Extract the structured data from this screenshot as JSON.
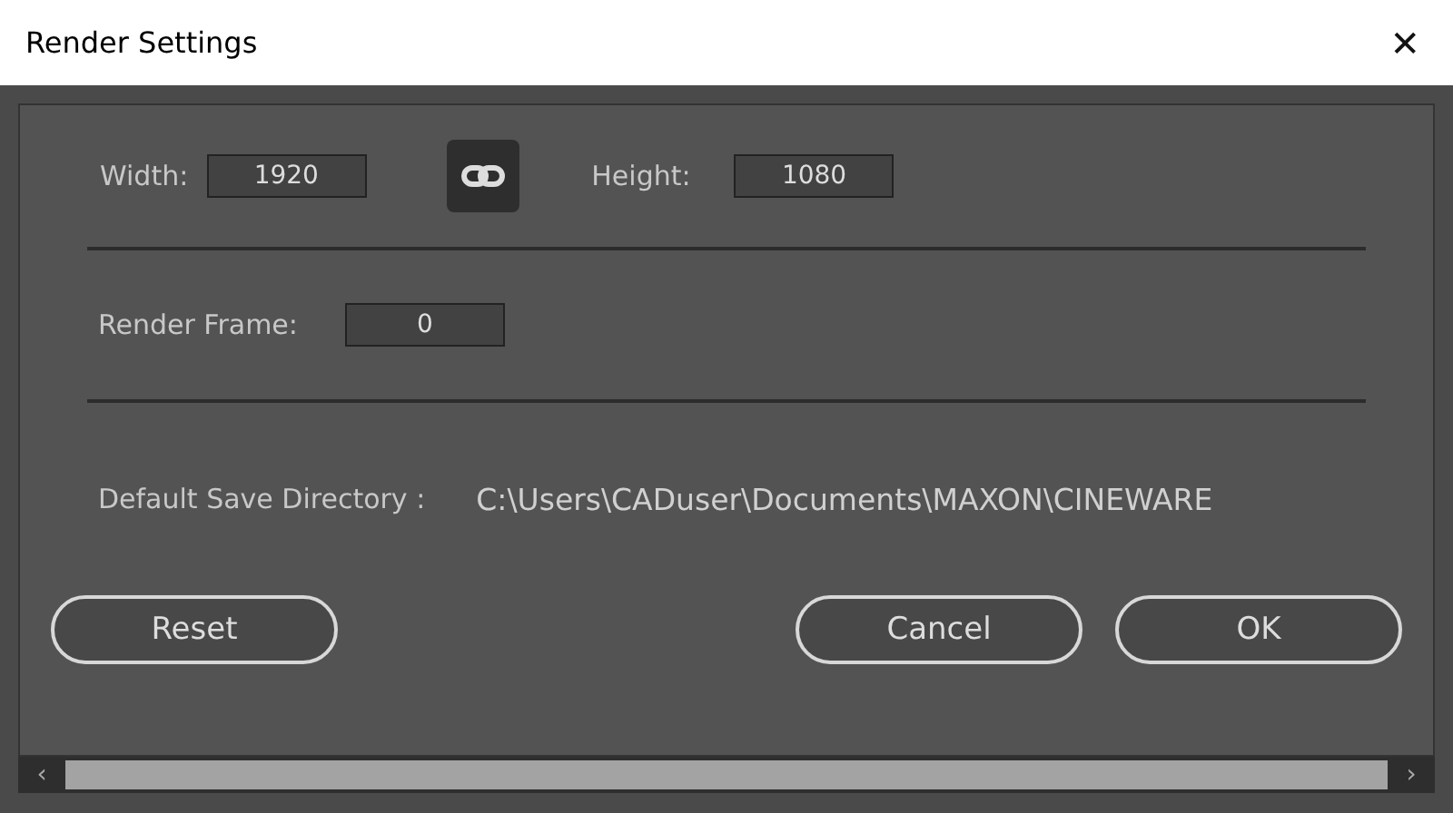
{
  "window": {
    "title": "Render Settings",
    "close": "✕"
  },
  "size": {
    "width_label": "Width:",
    "width_value": "1920",
    "link_on": true,
    "height_label": "Height:",
    "height_value": "1080"
  },
  "frame": {
    "label": "Render Frame:",
    "value": "0"
  },
  "directory": {
    "label": "Default Save Directory :",
    "path": "C:\\Users\\CADuser\\Documents\\MAXON\\CINEWARE"
  },
  "buttons": [
    {
      "label": "Reset",
      "kind": "left"
    },
    {
      "label": "Cancel",
      "kind": "right"
    },
    {
      "label": "OK",
      "kind": "right"
    }
  ],
  "scrollbar": {
    "left": "‹",
    "right": "›"
  }
}
